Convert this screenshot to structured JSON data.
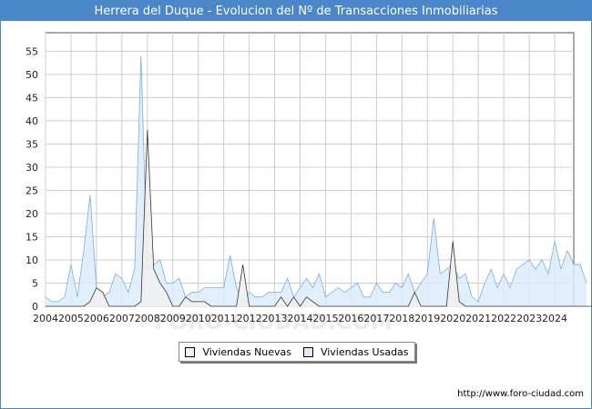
{
  "header": {
    "title": "Herrera del Duque - Evolucion del Nº de Transacciones Inmobiliarias"
  },
  "footer": {
    "source": "http://www.foro-ciudad.com"
  },
  "watermark": "FORO-CIUDAD.COM",
  "colors": {
    "title_bg": "#4a86c8",
    "nuevas_fill": "#f0f0f0",
    "nuevas_line": "#333333",
    "usadas_fill": "#dcecfb",
    "usadas_line": "#7aaee0",
    "grid": "#cccccc"
  },
  "chart_data": {
    "type": "area",
    "title": "Herrera del Duque - Evolucion del Nº de Transacciones Inmobiliarias",
    "xlabel": "",
    "ylabel": "",
    "x_start": 2004,
    "x_end": 2024.75,
    "ylim": [
      0,
      59
    ],
    "y_ticks": [
      0,
      5,
      10,
      15,
      20,
      25,
      30,
      35,
      40,
      45,
      50,
      55
    ],
    "x_ticks": [
      "2004",
      "2005",
      "2006",
      "2007",
      "2008",
      "2009",
      "2010",
      "2011",
      "2012",
      "2013",
      "2014",
      "2015",
      "2016",
      "2017",
      "2018",
      "2019",
      "2020",
      "2021",
      "2022",
      "2023",
      "2024"
    ],
    "grid": true,
    "legend_position": "bottom-center",
    "frequency": "quarterly",
    "series": [
      {
        "name": "Viviendas Nuevas",
        "values": [
          0,
          0,
          0,
          0,
          0,
          0,
          0,
          1,
          4,
          3,
          0,
          0,
          0,
          0,
          0,
          1,
          38,
          8,
          5,
          3,
          0,
          0,
          2,
          1,
          1,
          1,
          0,
          0,
          0,
          0,
          0,
          9,
          0,
          0,
          0,
          0,
          0,
          2,
          0,
          2,
          0,
          2,
          1,
          0,
          0,
          0,
          0,
          0,
          0,
          0,
          0,
          0,
          0,
          0,
          0,
          0,
          0,
          0,
          3,
          0,
          0,
          0,
          0,
          0,
          14,
          1,
          0,
          0,
          0,
          0,
          0,
          0,
          0,
          0,
          0,
          0,
          0,
          0,
          0,
          0,
          0,
          0,
          0,
          0,
          0,
          0,
          0,
          0,
          0,
          0,
          0,
          0
        ]
      },
      {
        "name": "Viviendas Usadas",
        "values": [
          2,
          1,
          1,
          2,
          9,
          2,
          12,
          24,
          4,
          2,
          3,
          7,
          6,
          3,
          8,
          54,
          8,
          9,
          10,
          5,
          5,
          6,
          2,
          3,
          3,
          4,
          4,
          4,
          4,
          11,
          4,
          1,
          3,
          2,
          2,
          3,
          3,
          3,
          6,
          2,
          4,
          6,
          4,
          7,
          2,
          3,
          4,
          3,
          4,
          5,
          2,
          2,
          5,
          3,
          3,
          5,
          4,
          7,
          3,
          5,
          7,
          19,
          7,
          8,
          9,
          6,
          7,
          2,
          1,
          5,
          8,
          4,
          7,
          4,
          8,
          9,
          10,
          8,
          10,
          7,
          14,
          8,
          12,
          9,
          9,
          5
        ]
      }
    ]
  }
}
